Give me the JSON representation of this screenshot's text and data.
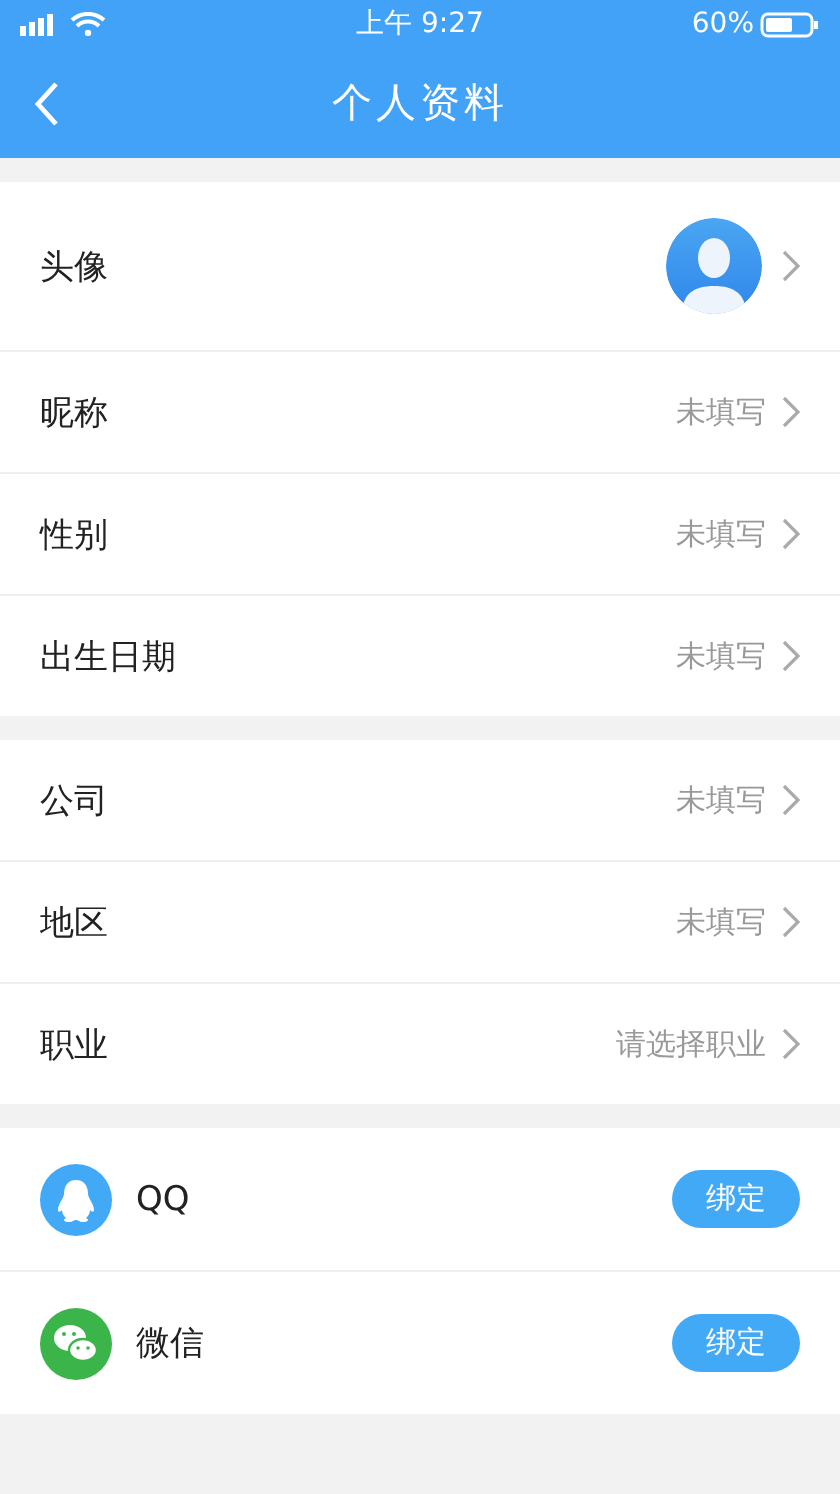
{
  "status_bar": {
    "time": "上午 9:27",
    "battery": "60%"
  },
  "nav": {
    "title": "个人资料"
  },
  "sections": [
    {
      "rows": [
        {
          "kind": "avatar",
          "label": "头像"
        },
        {
          "kind": "value",
          "label": "昵称",
          "value": "未填写"
        },
        {
          "kind": "value",
          "label": "性别",
          "value": "未填写"
        },
        {
          "kind": "value",
          "label": "出生日期",
          "value": "未填写"
        }
      ]
    },
    {
      "rows": [
        {
          "kind": "value",
          "label": "公司",
          "value": "未填写"
        },
        {
          "kind": "value",
          "label": "地区",
          "value": "未填写"
        },
        {
          "kind": "value",
          "label": "职业",
          "value": "请选择职业"
        }
      ]
    }
  ],
  "accounts": [
    {
      "kind": "qq",
      "label": "QQ",
      "button": "绑定"
    },
    {
      "kind": "wechat",
      "label": "微信",
      "button": "绑定"
    }
  ]
}
